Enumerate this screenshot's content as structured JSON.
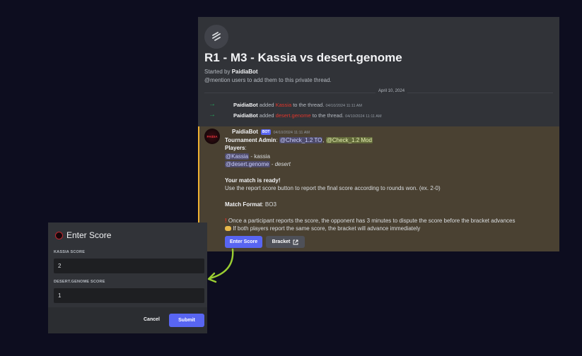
{
  "thread": {
    "title": "R1 - M3 - Kassia vs desert.genome",
    "started_prefix": "Started by ",
    "started_by": "PaidiaBot",
    "mention_hint": "@mention users to add them to this private thread.",
    "date_divider": "April 10, 2024",
    "icon": "threads-icon"
  },
  "system_messages": [
    {
      "actor": "PaidiaBot",
      "verb": " added ",
      "target": "Kassia",
      "suffix": " to the thread.",
      "timestamp": "04/10/2024 11:11 AM"
    },
    {
      "actor": "PaidiaBot",
      "verb": " added ",
      "target": "desert.genome",
      "suffix": " to the thread.",
      "timestamp": "04/10/2024 11:11 AM"
    }
  ],
  "bot_message": {
    "author": "PaidiaBot",
    "badge": "BOT",
    "timestamp": "04/10/2024 11:11 AM",
    "avatar_text": "PAIDIA",
    "admin_label": "Tournament Admin",
    "admin_sep": ": ",
    "admin_mention_1": "@Check_1.2 TO",
    "admin_comma": ", ",
    "admin_mention_2": "@Check_1.2 Mod",
    "players_label": "Players",
    "players_colon": ":",
    "player1_mention": "@Kassia",
    "player1_suffix": " - kassia",
    "player2_mention": "@desert.genome",
    "player2_suffix_dash": " - ",
    "player2_suffix": "desert",
    "ready_heading": "Your match is ready!",
    "ready_text": "Use the report score button to report the final score according to rounds won. (ex. 2-0)",
    "format_label": "Match Format",
    "format_value": ": BO3",
    "notice_1": "Once a participant reports the score, the opponent has 3 minutes to dispute the score before the bracket advances",
    "notice_2": "If both players report the same score, the bracket will advance immediately",
    "enter_score_button": "Enter Score",
    "bracket_button": "Bracket"
  },
  "modal": {
    "title": "Enter Score",
    "field1_label": "KASSIA SCORE",
    "field1_value": "2",
    "field2_label": "DESERT.GENOME SCORE",
    "field2_value": "1",
    "cancel_label": "Cancel",
    "submit_label": "Submit"
  },
  "colors": {
    "page_bg": "#0d0d1f",
    "panel_bg": "#313338",
    "highlight_bg": "#4a4132",
    "accent": "#5865f2",
    "arrow_green": "#9acd32",
    "name_red": "#e0352b"
  }
}
